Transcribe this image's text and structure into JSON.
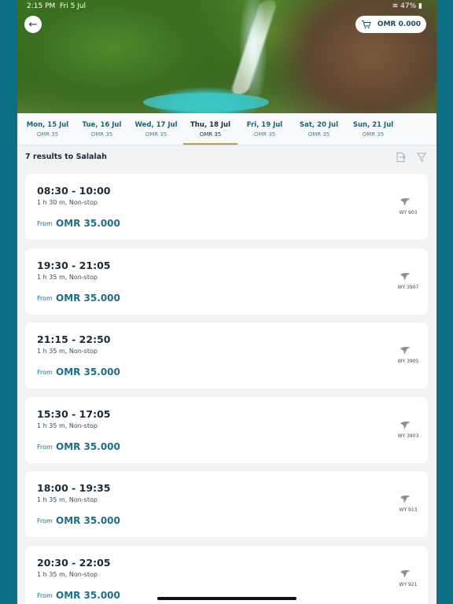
{
  "status_bar": {
    "time": "2:15 PM",
    "date": "Fri 5 Jul",
    "battery": "47%"
  },
  "header": {
    "cart_total": "OMR 0.000"
  },
  "dates": [
    {
      "label": "Mon, 15 Jul",
      "price": "OMR 35"
    },
    {
      "label": "Tue, 16 Jul",
      "price": "OMR 35"
    },
    {
      "label": "Wed, 17 Jul",
      "price": "OMR 35"
    },
    {
      "label": "Thu, 18 Jul",
      "price": "OMR 35",
      "selected": true
    },
    {
      "label": "Fri, 19 Jul",
      "price": "OMR 35"
    },
    {
      "label": "Sat, 20 Jul",
      "price": "OMR 35"
    },
    {
      "label": "Sun, 21 Jul",
      "price": "OMR 35"
    }
  ],
  "results": {
    "count_label": "7 results to Salalah"
  },
  "flights": [
    {
      "times": "08:30 - 10:00",
      "duration": "1 h 30 m, Non-stop",
      "from_label": "From",
      "price": "OMR 35.000",
      "flight_no": "WY 903"
    },
    {
      "times": "19:30 - 21:05",
      "duration": "1 h 35 m, Non-stop",
      "from_label": "From",
      "price": "OMR 35.000",
      "flight_no": "WY 3907"
    },
    {
      "times": "21:15 - 22:50",
      "duration": "1 h 35 m, Non-stop",
      "from_label": "From",
      "price": "OMR 35.000",
      "flight_no": "WY 3905"
    },
    {
      "times": "15:30 - 17:05",
      "duration": "1 h 35 m, Non-stop",
      "from_label": "From",
      "price": "OMR 35.000",
      "flight_no": "WY 3903"
    },
    {
      "times": "18:00 - 19:35",
      "duration": "1 h 35 m, Non-stop",
      "from_label": "From",
      "price": "OMR 35.000",
      "flight_no": "WY 913"
    },
    {
      "times": "20:30 - 22:05",
      "duration": "1 h 35 m, Non-stop",
      "from_label": "From",
      "price": "OMR 35.000",
      "flight_no": "WY 921"
    }
  ],
  "icons": {
    "back": "arrow-left-icon",
    "cart": "cart-icon",
    "sort": "sort-icon",
    "filter": "filter-icon",
    "airline": "oman-air-logo-icon"
  },
  "colors": {
    "frame": "#0c6f84",
    "accent": "#1d6f86",
    "tab_underline": "#b89b5e"
  }
}
